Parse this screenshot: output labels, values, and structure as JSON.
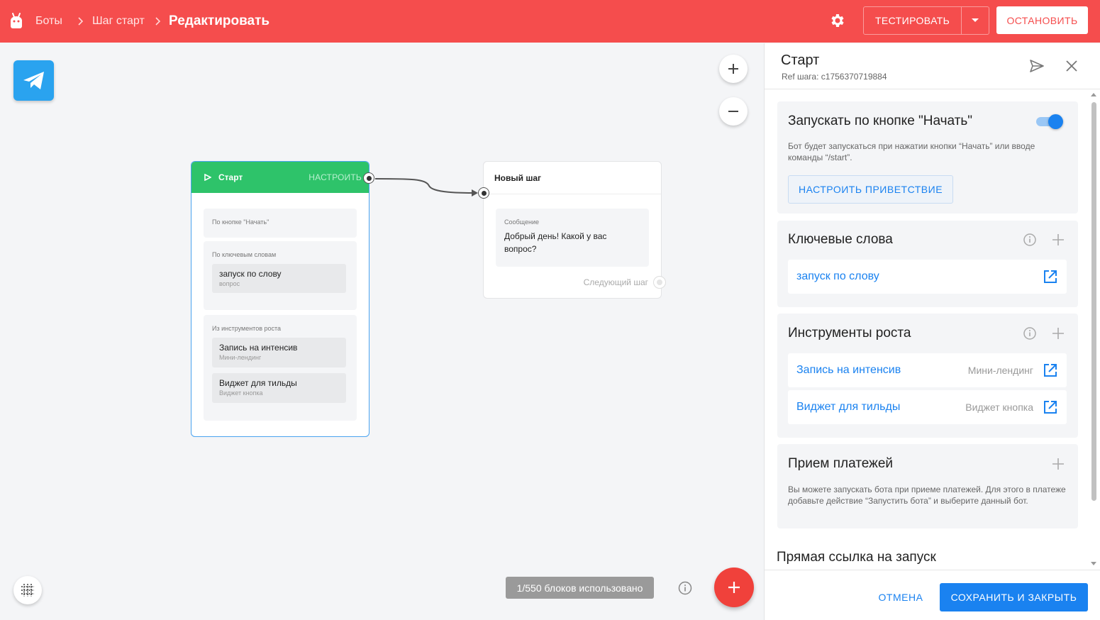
{
  "header": {
    "breadcrumbs": [
      "Боты",
      "Шаг старт",
      "Редактировать"
    ],
    "test_label": "ТЕСТИРОВАТЬ",
    "stop_label": "ОСТАНОВИТЬ"
  },
  "canvas": {
    "usage_label": "1/550 блоков использовано",
    "start_node": {
      "title": "Старт",
      "configure_label": "НАСТРОИТЬ",
      "sections": [
        {
          "title": "По кнопке \"Начать\"",
          "items": []
        },
        {
          "title": "По ключевым словам",
          "items": [
            {
              "title": "запуск по слову",
              "subtitle": "вопрос"
            }
          ]
        },
        {
          "title": "Из инструментов роста",
          "items": [
            {
              "title": "Запись на интенсив",
              "subtitle": "Мини-лендинг"
            },
            {
              "title": "Виджет для тильды",
              "subtitle": "Виджет кнопка"
            }
          ]
        }
      ]
    },
    "step_node": {
      "title": "Новый шаг",
      "message_label": "Сообщение",
      "message_text": "Добрый день! Какой у вас вопрос?",
      "next_label": "Следующий шаг"
    }
  },
  "panel": {
    "title": "Старт",
    "ref": "Ref шага: c1756370719884",
    "start_button_card": {
      "title": "Запускать по кнопке \"Начать\"",
      "enabled": true,
      "description": "Бот будет запускаться при нажатии кнопки “Начать” или вводе команды “/start”.",
      "button_label": "НАСТРОИТЬ ПРИВЕТСТВИЕ"
    },
    "keywords_card": {
      "title": "Ключевые слова",
      "items": [
        {
          "label": "запуск по слову"
        }
      ]
    },
    "growth_card": {
      "title": "Инструменты роста",
      "items": [
        {
          "label": "Запись на интенсив",
          "type": "Мини-лендинг"
        },
        {
          "label": "Виджет для тильды",
          "type": "Виджет кнопка"
        }
      ]
    },
    "payments_card": {
      "title": "Прием платежей",
      "description": "Вы можете запускать бота при приеме платежей. Для этого в платеже добавьте действие “Запустить бота” и выберите данный бот."
    },
    "direct_link_title": "Прямая ссылка на запуск",
    "cancel_label": "ОТМЕНА",
    "save_label": "СОХРАНИТЬ И ЗАКРЫТЬ"
  },
  "colors": {
    "header_bg": "#f54d4d",
    "start_green": "#2ec36a",
    "accent_blue": "#1a82f0",
    "telegram_blue": "#2aa3ef",
    "fab_red": "#f0413b"
  },
  "icons": [
    "bot-logo-icon",
    "chevron-right-icon",
    "gear-icon",
    "caret-down-icon",
    "telegram-icon",
    "plus-icon",
    "minus-icon",
    "grid-icon",
    "info-icon",
    "play-icon",
    "send-icon",
    "close-icon",
    "open-external-icon"
  ]
}
